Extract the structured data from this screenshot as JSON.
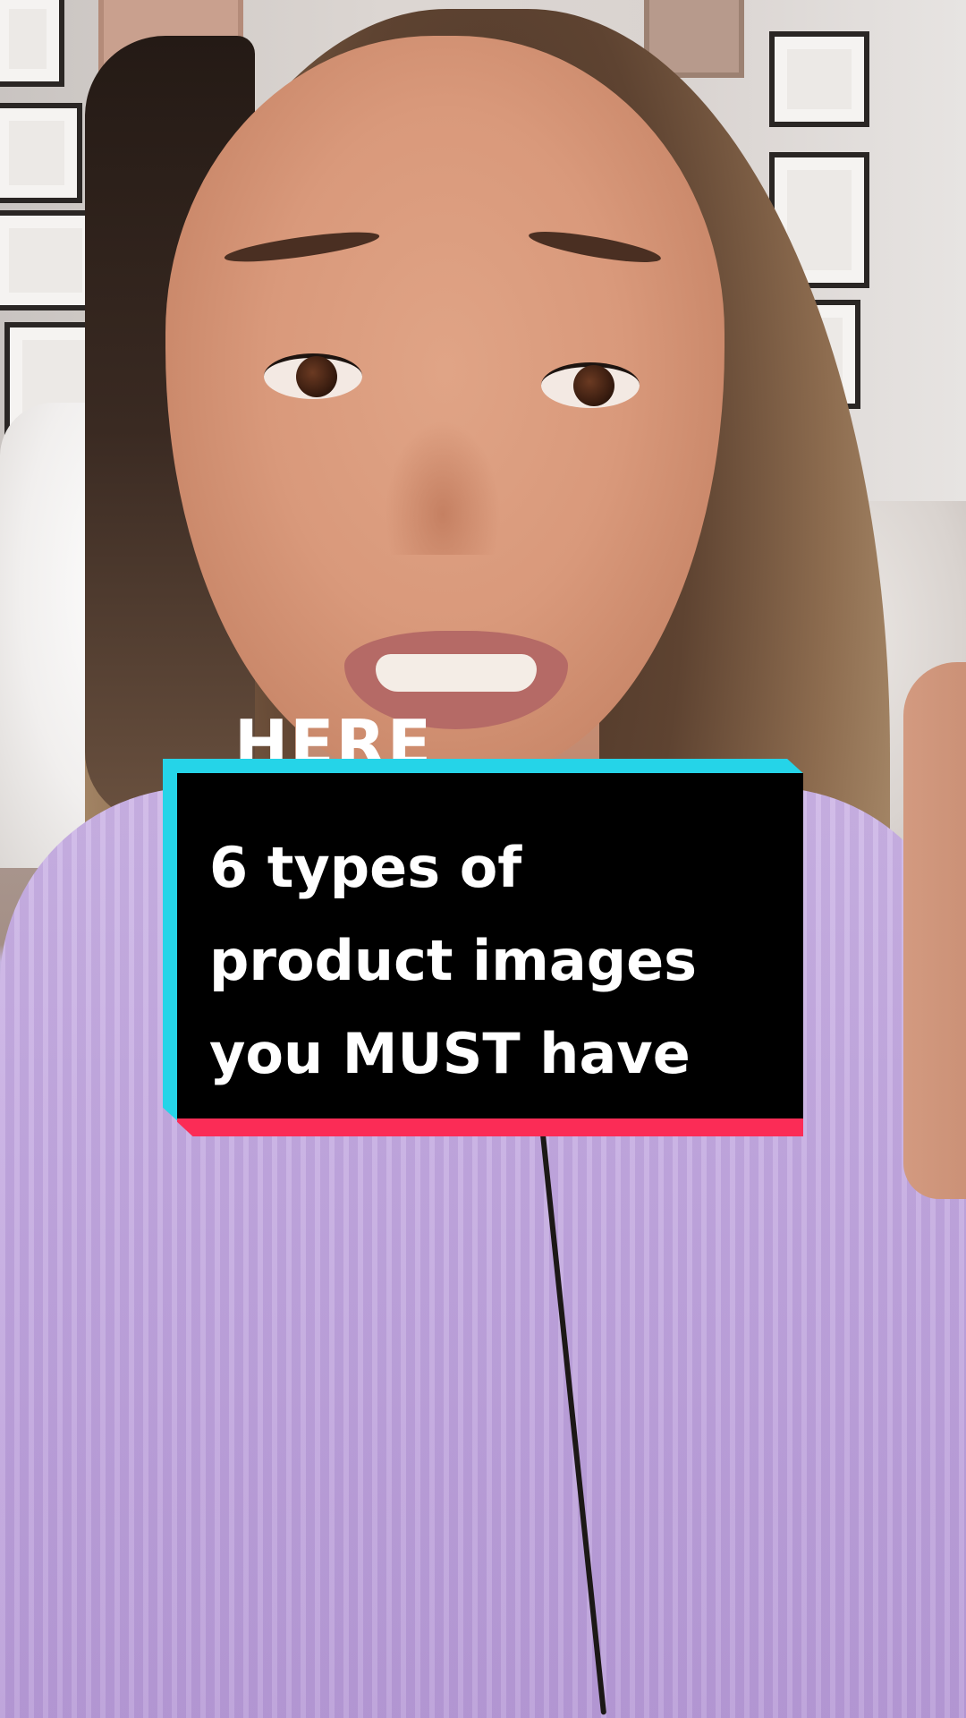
{
  "video": {
    "background_text": "HERE",
    "caption": "6 types of product images you MUST have"
  },
  "colors": {
    "caption_background": "#000000",
    "caption_text": "#ffffff",
    "caption_shadow_cyan": "#25d4e8",
    "caption_shadow_red": "#fb2c56",
    "sweater": "#c2a8df"
  }
}
